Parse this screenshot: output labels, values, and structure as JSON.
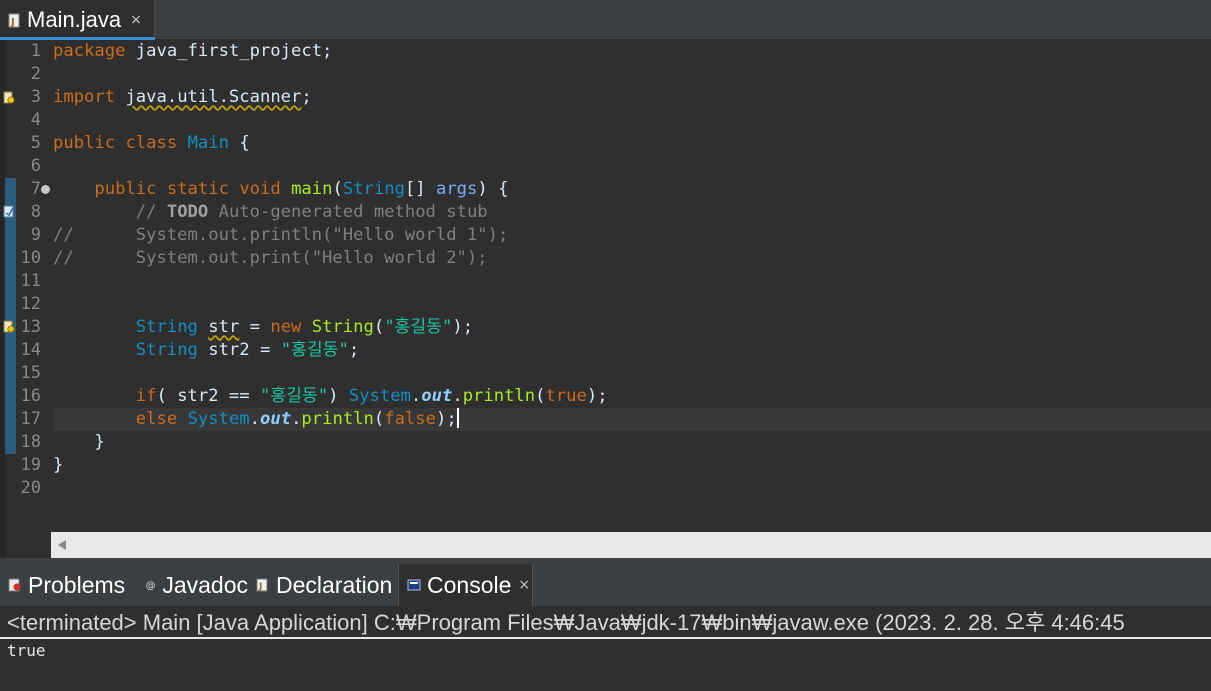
{
  "editor_tab": {
    "file_name": "Main.java",
    "close_glyph": "×",
    "icon": "java-file-icon"
  },
  "line_numbers": [
    "1",
    "2",
    "3",
    "4",
    "5",
    "6",
    "7",
    "8",
    "9",
    "10",
    "11",
    "12",
    "13",
    "14",
    "15",
    "16",
    "17",
    "18",
    "19",
    "20"
  ],
  "code": {
    "line1": {
      "kw": "package",
      "rest": " java_first_project;"
    },
    "line3": {
      "kw": "import",
      "pkg": "java.util.Scanner",
      "semi": ";"
    },
    "line5": {
      "kw1": "public",
      "kw2": "class",
      "cls": "Main",
      "brace": " {"
    },
    "line7": {
      "kw1": "public",
      "kw2": "static",
      "kw3": "void",
      "method": "main",
      "open": "(",
      "type": "String",
      "arr": "[] ",
      "param": "args",
      "close": ") {"
    },
    "line8": {
      "prefix": "// ",
      "todo": "TODO",
      "rest": " Auto-generated method stub"
    },
    "line9": {
      "text": "//      System.out.println(\"Hello world 1\");"
    },
    "line10": {
      "text": "//      System.out.print(\"Hello world 2\");"
    },
    "line13": {
      "type1": "String",
      "var": "str",
      "eq": " = ",
      "kw": "new",
      "type2": "String",
      "open": "(",
      "str": "\"홍길동\"",
      "close": ");"
    },
    "line14": {
      "type": "String",
      "rest": " str2 = ",
      "str": "\"홍길동\"",
      "semi": ";"
    },
    "line16": {
      "kw": "if",
      "mid": "( str2 == ",
      "str": "\"홍길동\"",
      "close": ") ",
      "sys": "System",
      "dot1": ".",
      "out": "out",
      "dot2": ".",
      "method": "println",
      "open": "(",
      "val": "true",
      "end": ");"
    },
    "line17": {
      "kw": "else",
      "sys": "System",
      "dot1": ".",
      "out": "out",
      "dot2": ".",
      "method": "println",
      "open": "(",
      "val": "false",
      "end": ");"
    },
    "line18": {
      "text": "    }"
    },
    "line19": {
      "text": "}"
    }
  },
  "panel_tabs": [
    {
      "label": "Problems",
      "icon": "problems-icon"
    },
    {
      "label": "Javadoc",
      "icon": "javadoc-icon"
    },
    {
      "label": "Declaration",
      "icon": "declaration-icon"
    },
    {
      "label": "Console",
      "icon": "console-icon",
      "close_glyph": "×",
      "active": true
    }
  ],
  "console": {
    "status_line": "<terminated> Main [Java Application] C:₩Program Files₩Java₩jdk-17₩bin₩javaw.exe  (2023. 2. 28. 오후 4:46:45",
    "output": "true"
  },
  "colors": {
    "keyword": "#cc6c1d",
    "type": "#1290c3",
    "method": "#a7ec21",
    "string": "#17c6a3",
    "comment": "#808080",
    "parameter": "#79abff",
    "static_field": "#8dd0ff",
    "editor_bg": "#2f2f2f",
    "current_line": "#383838",
    "change_bar": "#2a5e7c"
  }
}
